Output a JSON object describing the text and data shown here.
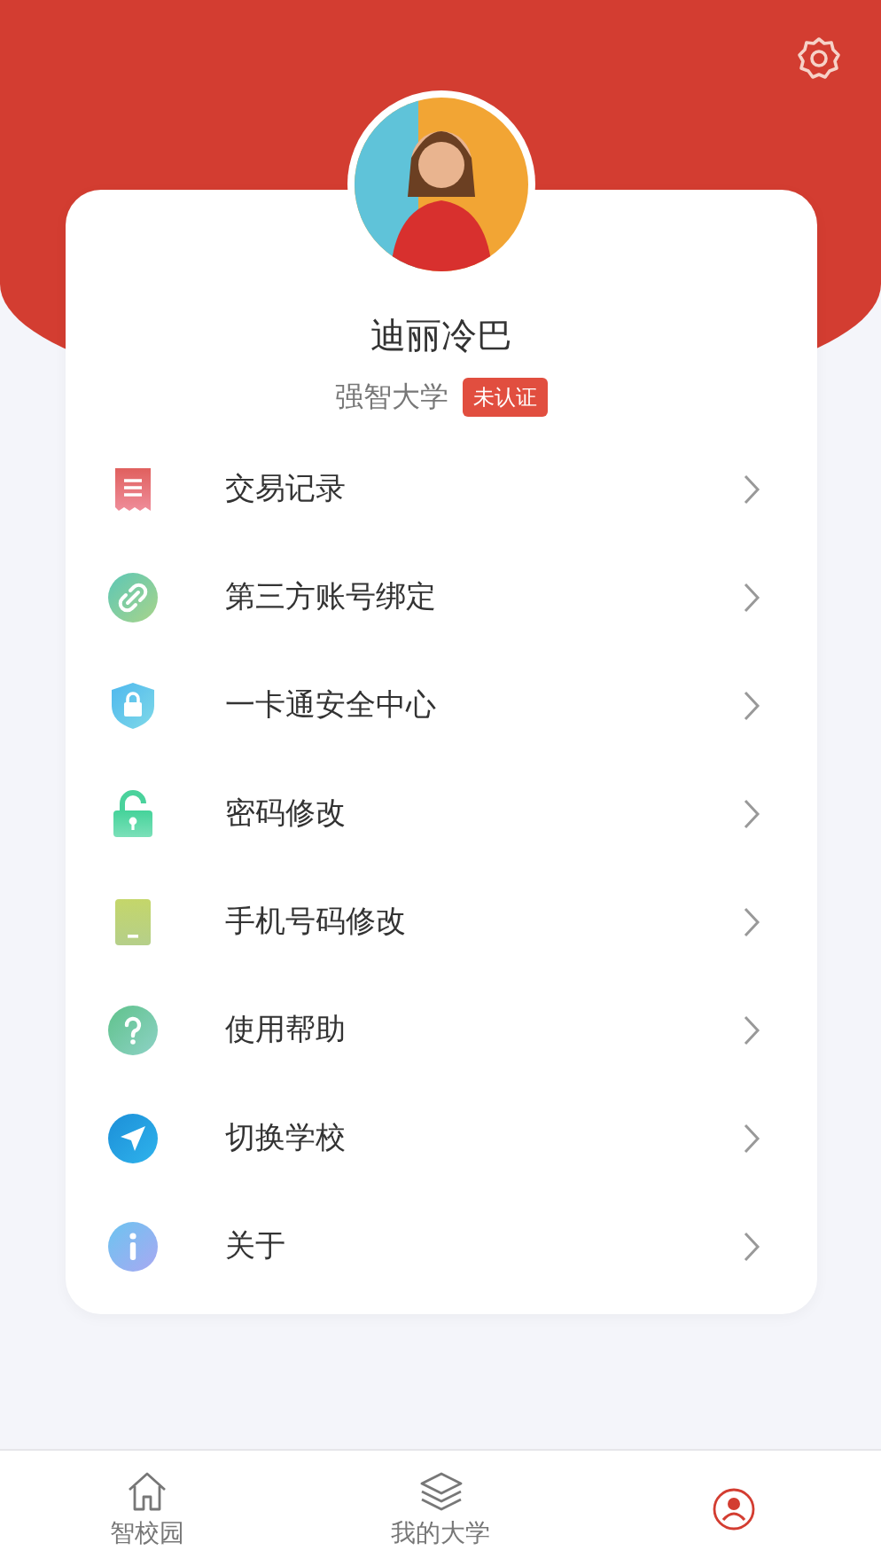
{
  "profile": {
    "name": "迪丽冷巴",
    "school": "强智大学",
    "badge": "未认证"
  },
  "menu": [
    {
      "label": "交易记录"
    },
    {
      "label": "第三方账号绑定"
    },
    {
      "label": "一卡通安全中心"
    },
    {
      "label": "密码修改"
    },
    {
      "label": "手机号码修改"
    },
    {
      "label": "使用帮助"
    },
    {
      "label": "切换学校"
    },
    {
      "label": "关于"
    }
  ],
  "tabs": [
    {
      "label": "智校园",
      "selected": false
    },
    {
      "label": "我的大学",
      "selected": false
    },
    {
      "selected": true
    }
  ]
}
